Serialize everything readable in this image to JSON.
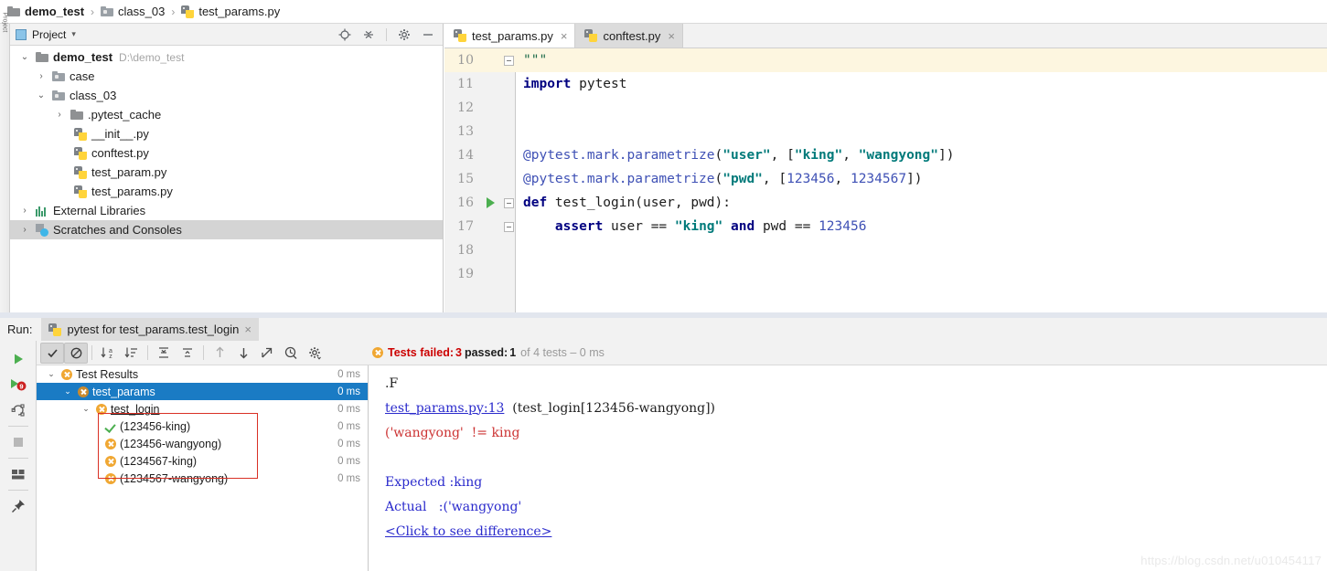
{
  "breadcrumb": {
    "items": [
      {
        "label": "demo_test",
        "icon": "folder-icon",
        "bold": true
      },
      {
        "label": "class_03",
        "icon": "folder-icon",
        "bold": false
      },
      {
        "label": "test_params.py",
        "icon": "python-file-icon",
        "bold": false
      }
    ],
    "separator": "›"
  },
  "project_panel": {
    "title": "Project",
    "caret": "▾",
    "toolbar_icons": [
      "locate-icon",
      "collapse-all-icon",
      "gear-icon",
      "minimize-icon"
    ],
    "tree": [
      {
        "label": "demo_test",
        "sub": "D:\\demo_test",
        "icon": "folder-icon",
        "twisty": "⌄",
        "indent": 0,
        "bold": true,
        "selected": false
      },
      {
        "label": "case",
        "sub": "",
        "icon": "folder-icon",
        "twisty": "›",
        "indent": 1,
        "bold": false,
        "selected": false
      },
      {
        "label": "class_03",
        "sub": "",
        "icon": "folder-icon",
        "twisty": "⌄",
        "indent": 1,
        "bold": false,
        "selected": false
      },
      {
        "label": ".pytest_cache",
        "sub": "",
        "icon": "folder-icon",
        "twisty": "›",
        "indent": 2,
        "bold": false,
        "selected": false
      },
      {
        "label": "__init__.py",
        "sub": "",
        "icon": "python-file-icon",
        "twisty": "",
        "indent": 3,
        "bold": false,
        "selected": false
      },
      {
        "label": "conftest.py",
        "sub": "",
        "icon": "python-file-icon",
        "twisty": "",
        "indent": 3,
        "bold": false,
        "selected": false
      },
      {
        "label": "test_param.py",
        "sub": "",
        "icon": "python-file-icon",
        "twisty": "",
        "indent": 3,
        "bold": false,
        "selected": false
      },
      {
        "label": "test_params.py",
        "sub": "",
        "icon": "python-file-icon",
        "twisty": "",
        "indent": 3,
        "bold": false,
        "selected": false
      },
      {
        "label": "External Libraries",
        "sub": "",
        "icon": "library-icon",
        "twisty": "›",
        "indent": 0,
        "bold": false,
        "selected": false
      },
      {
        "label": "Scratches and Consoles",
        "sub": "",
        "icon": "scratches-icon",
        "twisty": "›",
        "indent": 0,
        "bold": false,
        "selected": true
      }
    ],
    "vertical_tab_label": "Project"
  },
  "editor": {
    "tabs": [
      {
        "label": "test_params.py",
        "icon": "python-file-icon",
        "active": true,
        "close": "×"
      },
      {
        "label": "conftest.py",
        "icon": "python-file-icon",
        "active": false,
        "close": "×"
      }
    ],
    "lines": [
      {
        "number": "10",
        "highlight": true,
        "fold": "end",
        "runmark": false,
        "tokens": [
          {
            "t": "\"\"\"",
            "c": "k-doc"
          }
        ]
      },
      {
        "number": "11",
        "highlight": false,
        "fold": "none",
        "runmark": false,
        "tokens": [
          {
            "t": "import",
            "c": "k-kw"
          },
          {
            "t": " pytest",
            "c": "k-txt"
          }
        ]
      },
      {
        "number": "12",
        "highlight": false,
        "fold": "none",
        "runmark": false,
        "tokens": []
      },
      {
        "number": "13",
        "highlight": false,
        "fold": "none",
        "runmark": false,
        "tokens": []
      },
      {
        "number": "14",
        "highlight": false,
        "fold": "none",
        "runmark": false,
        "tokens": [
          {
            "t": "@pytest.mark.parametrize",
            "c": "k-dec"
          },
          {
            "t": "(",
            "c": "k-txt"
          },
          {
            "t": "\"user\"",
            "c": "k-str"
          },
          {
            "t": ", [",
            "c": "k-txt"
          },
          {
            "t": "\"king\"",
            "c": "k-str"
          },
          {
            "t": ", ",
            "c": "k-txt"
          },
          {
            "t": "\"wangyong\"",
            "c": "k-str"
          },
          {
            "t": "])",
            "c": "k-txt"
          }
        ]
      },
      {
        "number": "15",
        "highlight": false,
        "fold": "none",
        "runmark": false,
        "tokens": [
          {
            "t": "@pytest.mark.parametrize",
            "c": "k-dec"
          },
          {
            "t": "(",
            "c": "k-txt"
          },
          {
            "t": "\"pwd\"",
            "c": "k-str"
          },
          {
            "t": ", [",
            "c": "k-txt"
          },
          {
            "t": "123456",
            "c": "k-num"
          },
          {
            "t": ", ",
            "c": "k-txt"
          },
          {
            "t": "1234567",
            "c": "k-num"
          },
          {
            "t": "])",
            "c": "k-txt"
          }
        ]
      },
      {
        "number": "16",
        "highlight": false,
        "fold": "start",
        "runmark": true,
        "tokens": [
          {
            "t": "def",
            "c": "k-def"
          },
          {
            "t": " test_login(user, pwd):",
            "c": "k-txt"
          }
        ]
      },
      {
        "number": "17",
        "highlight": false,
        "fold": "end",
        "runmark": false,
        "tokens": [
          {
            "t": "    ",
            "c": "k-txt"
          },
          {
            "t": "assert",
            "c": "k-kw"
          },
          {
            "t": " user == ",
            "c": "k-txt"
          },
          {
            "t": "\"king\"",
            "c": "k-str"
          },
          {
            "t": " ",
            "c": "k-txt"
          },
          {
            "t": "and",
            "c": "k-kw"
          },
          {
            "t": " pwd == ",
            "c": "k-txt"
          },
          {
            "t": "123456",
            "c": "k-num"
          }
        ]
      },
      {
        "number": "18",
        "highlight": false,
        "fold": "none",
        "runmark": false,
        "tokens": []
      },
      {
        "number": "19",
        "highlight": false,
        "fold": "none",
        "runmark": false,
        "tokens": []
      }
    ]
  },
  "run_window": {
    "label": "Run:",
    "tab": {
      "label": "pytest for test_params.test_login",
      "icon": "python-run-icon",
      "close": "×"
    },
    "left_toolbar": [
      {
        "name": "rerun-icon"
      },
      {
        "name": "rerun-failed-tests-icon",
        "badge": "9"
      },
      {
        "name": "rerun-automatically-icon"
      },
      {
        "name": "stop-icon"
      },
      {
        "name": "layout-icon"
      },
      {
        "name": "pin-tab-icon"
      }
    ],
    "toolbar": [
      {
        "name": "show-passed-toggle",
        "glyph": "✔",
        "active": true
      },
      {
        "name": "hide-ignored-toggle",
        "glyph": "⊘",
        "active": true
      },
      {
        "name": "sort-alphabetically-icon",
        "glyph": "⇵a",
        "active": false
      },
      {
        "name": "sort-by-duration-icon",
        "glyph": "⇵",
        "active": false
      },
      {
        "name": "expand-all-icon",
        "glyph": "≡",
        "active": false
      },
      {
        "name": "collapse-all-icon",
        "glyph": "≃",
        "active": false
      },
      {
        "name": "prev-failed-test-icon",
        "glyph": "↑",
        "active": false
      },
      {
        "name": "next-failed-test-icon",
        "glyph": "↓",
        "active": false
      },
      {
        "name": "export-test-results-icon",
        "glyph": "↗",
        "active": false
      },
      {
        "name": "test-history-icon",
        "glyph": "◴",
        "active": false
      },
      {
        "name": "settings-gear-icon",
        "glyph": "⚙",
        "active": false
      }
    ],
    "status": {
      "icon": "error-icon",
      "failed_label": "Tests failed:",
      "failed_count": "3",
      "passed_label": "passed:",
      "passed_count": "1",
      "suffix": "of 4 tests – 0 ms"
    },
    "tests": [
      {
        "label": "Test Results",
        "status": "failed",
        "ms": "0 ms",
        "indent": 0,
        "twisty": "⌄",
        "selected": false,
        "underline": false
      },
      {
        "label": "test_params",
        "status": "failed",
        "ms": "0 ms",
        "indent": 1,
        "twisty": "⌄",
        "selected": true,
        "underline": false
      },
      {
        "label": "test_login",
        "status": "failed",
        "ms": "0 ms",
        "indent": 2,
        "twisty": "⌄",
        "selected": false,
        "underline": true
      },
      {
        "label": "(123456-king)",
        "status": "passed",
        "ms": "0 ms",
        "indent": 3,
        "twisty": "",
        "selected": false,
        "underline": false
      },
      {
        "label": "(123456-wangyong)",
        "status": "failed",
        "ms": "0 ms",
        "indent": 3,
        "twisty": "",
        "selected": false,
        "underline": false
      },
      {
        "label": "(1234567-king)",
        "status": "failed",
        "ms": "0 ms",
        "indent": 3,
        "twisty": "",
        "selected": false,
        "underline": false
      },
      {
        "label": "(1234567-wangyong)",
        "status": "failed",
        "ms": "0 ms",
        "indent": 3,
        "twisty": "",
        "selected": false,
        "underline": false
      }
    ],
    "console": [
      {
        "parts": [
          {
            "t": ".F",
            "c": ""
          }
        ]
      },
      {
        "parts": [
          {
            "t": "test_params.py:13",
            "c": "c-link"
          },
          {
            "t": "  (test_login[123456-wangyong])",
            "c": ""
          }
        ]
      },
      {
        "parts": [
          {
            "t": "('wangyong'  != king",
            "c": "c-red"
          }
        ]
      },
      {
        "parts": [
          {
            "t": "",
            "c": ""
          }
        ]
      },
      {
        "parts": [
          {
            "t": "Expected :king",
            "c": "c-blue"
          }
        ]
      },
      {
        "parts": [
          {
            "t": "Actual   :('wangyong'",
            "c": "c-blue"
          }
        ]
      },
      {
        "parts": [
          {
            "t": "<Click to see difference>",
            "c": "c-link"
          }
        ]
      }
    ]
  },
  "watermark": "https://blog.csdn.net/u010454117",
  "colors": {
    "selection_blue": "#1a7bc4",
    "fail_orange": "#f0a732",
    "pass_green": "#4caf50",
    "error_red": "#cc0000",
    "annotation_red": "#d93025",
    "line_highlight": "#fdf6e0"
  }
}
